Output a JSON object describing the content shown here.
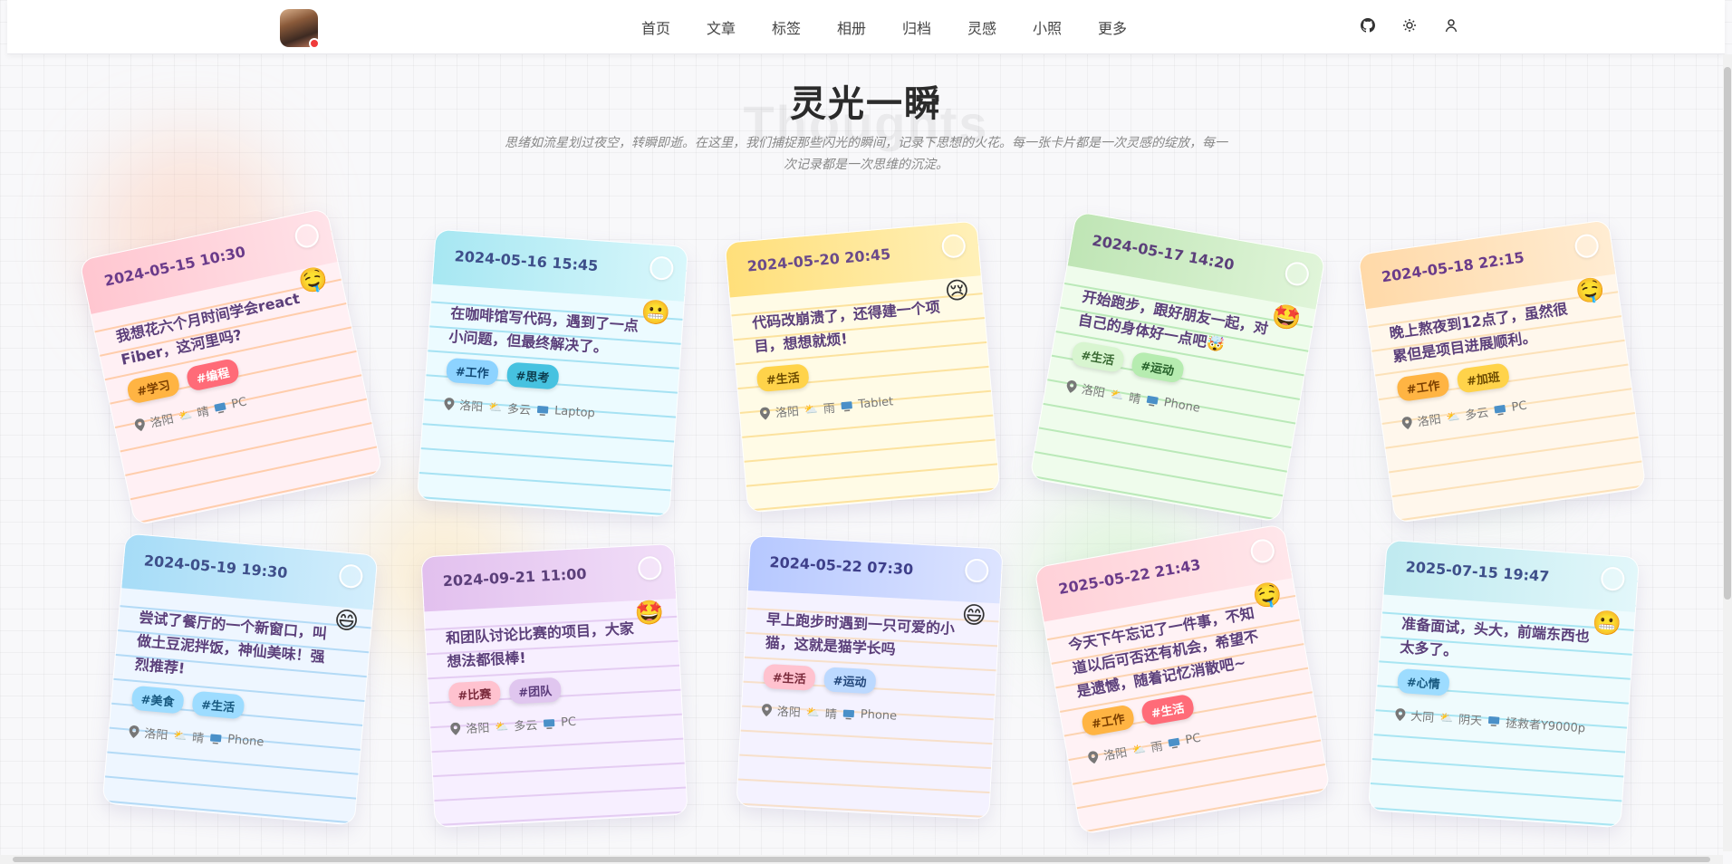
{
  "nav": {
    "items": [
      "首页",
      "文章",
      "标签",
      "相册",
      "归档",
      "灵感",
      "小照",
      "更多"
    ],
    "actions": [
      "github-icon",
      "theme-toggle-icon",
      "user-icon"
    ]
  },
  "hero": {
    "bg_text": "Thoughts",
    "title": "灵光一瞬",
    "subtitle": "思绪如流星划过夜空，转瞬即逝。在这里，我们捕捉那些闪光的瞬间，记录下思想的火花。每一张卡片都是一次灵感的绽放，每一次记录都是一次思维的沉淀。"
  },
  "cards": [
    {
      "date": "2024-05-15 10:30",
      "emoji": "🤤",
      "text": "我想花六个月时间学会react Fiber，这河里吗?",
      "tags": [
        "#学习",
        "#编程"
      ],
      "location": "洛阳",
      "weather": "晴",
      "device": "PC"
    },
    {
      "date": "2024-05-16 15:45",
      "emoji": "😬",
      "text": "在咖啡馆写代码，遇到了一点小问题，但最终解决了。",
      "tags": [
        "#工作",
        "#思考"
      ],
      "location": "洛阳",
      "weather": "多云",
      "device": "Laptop"
    },
    {
      "date": "2024-05-20 20:45",
      "emoji": "😢",
      "text": "代码改崩溃了，还得建一个项目，想想就烦!",
      "tags": [
        "#生活"
      ],
      "location": "洛阳",
      "weather": "雨",
      "device": "Tablet"
    },
    {
      "date": "2024-05-17 14:20",
      "emoji": "🤩",
      "text": "开始跑步，跟好朋友一起，对自己的身体好一点吧🤯",
      "tags": [
        "#生活",
        "#运动"
      ],
      "location": "洛阳",
      "weather": "晴",
      "device": "Phone"
    },
    {
      "date": "2024-05-18 22:15",
      "emoji": "🤤",
      "text": "晚上熬夜到12点了，虽然很累但是项目进展顺利。",
      "tags": [
        "#工作",
        "#加班"
      ],
      "location": "洛阳",
      "weather": "多云",
      "device": "PC"
    },
    {
      "date": "2024-05-19 19:30",
      "emoji": "😄",
      "text": "尝试了餐厅的一个新窗口，叫做土豆泥拌饭，神仙美味！强烈推荐!",
      "tags": [
        "#美食",
        "#生活"
      ],
      "location": "洛阳",
      "weather": "晴",
      "device": "Phone"
    },
    {
      "date": "2024-09-21 11:00",
      "emoji": "🤩",
      "text": "和团队讨论比赛的项目，大家想法都很棒!",
      "tags": [
        "#比赛",
        "#团队"
      ],
      "location": "洛阳",
      "weather": "多云",
      "device": "PC"
    },
    {
      "date": "2024-05-22 07:30",
      "emoji": "😄",
      "text": "早上跑步时遇到一只可爱的小猫，这就是猫学长吗",
      "tags": [
        "#生活",
        "#运动"
      ],
      "location": "洛阳",
      "weather": "晴",
      "device": "Phone"
    },
    {
      "date": "2025-05-22 21:43",
      "emoji": "🤤",
      "text": "今天下午忘记了一件事，不知道以后可否还有机会，希望不是遗憾，随着记忆消散吧~",
      "tags": [
        "#工作",
        "#生活"
      ],
      "location": "洛阳",
      "weather": "雨",
      "device": "PC"
    },
    {
      "date": "2025-07-15 19:47",
      "emoji": "😬",
      "text": "准备面试，头大，前端东西也太多了。",
      "tags": [
        "#心情"
      ],
      "location": "大同",
      "weather": "阴天",
      "device": "拯救者Y9000p"
    }
  ]
}
